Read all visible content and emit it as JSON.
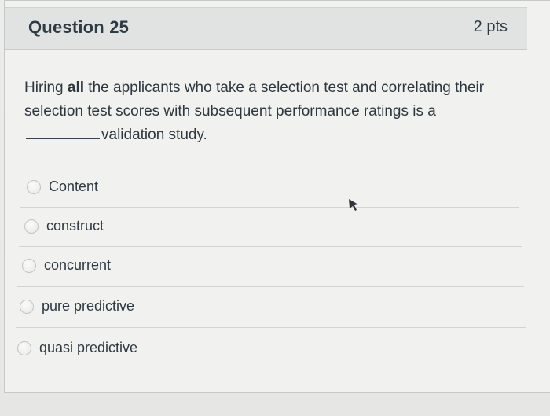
{
  "question": {
    "title": "Question 25",
    "points": "2 pts",
    "prompt_before_bold": "Hiring ",
    "prompt_bold": "all",
    "prompt_middle": " the applicants who take a selection test and correlating their selection test scores with subsequent performance ratings is a",
    "prompt_after_blank": "validation study."
  },
  "answers": [
    {
      "label": "Content"
    },
    {
      "label": "construct"
    },
    {
      "label": "concurrent"
    },
    {
      "label": "pure predictive"
    },
    {
      "label": "quasi predictive"
    }
  ],
  "icons": {
    "cursor": "mouse-pointer-icon"
  }
}
